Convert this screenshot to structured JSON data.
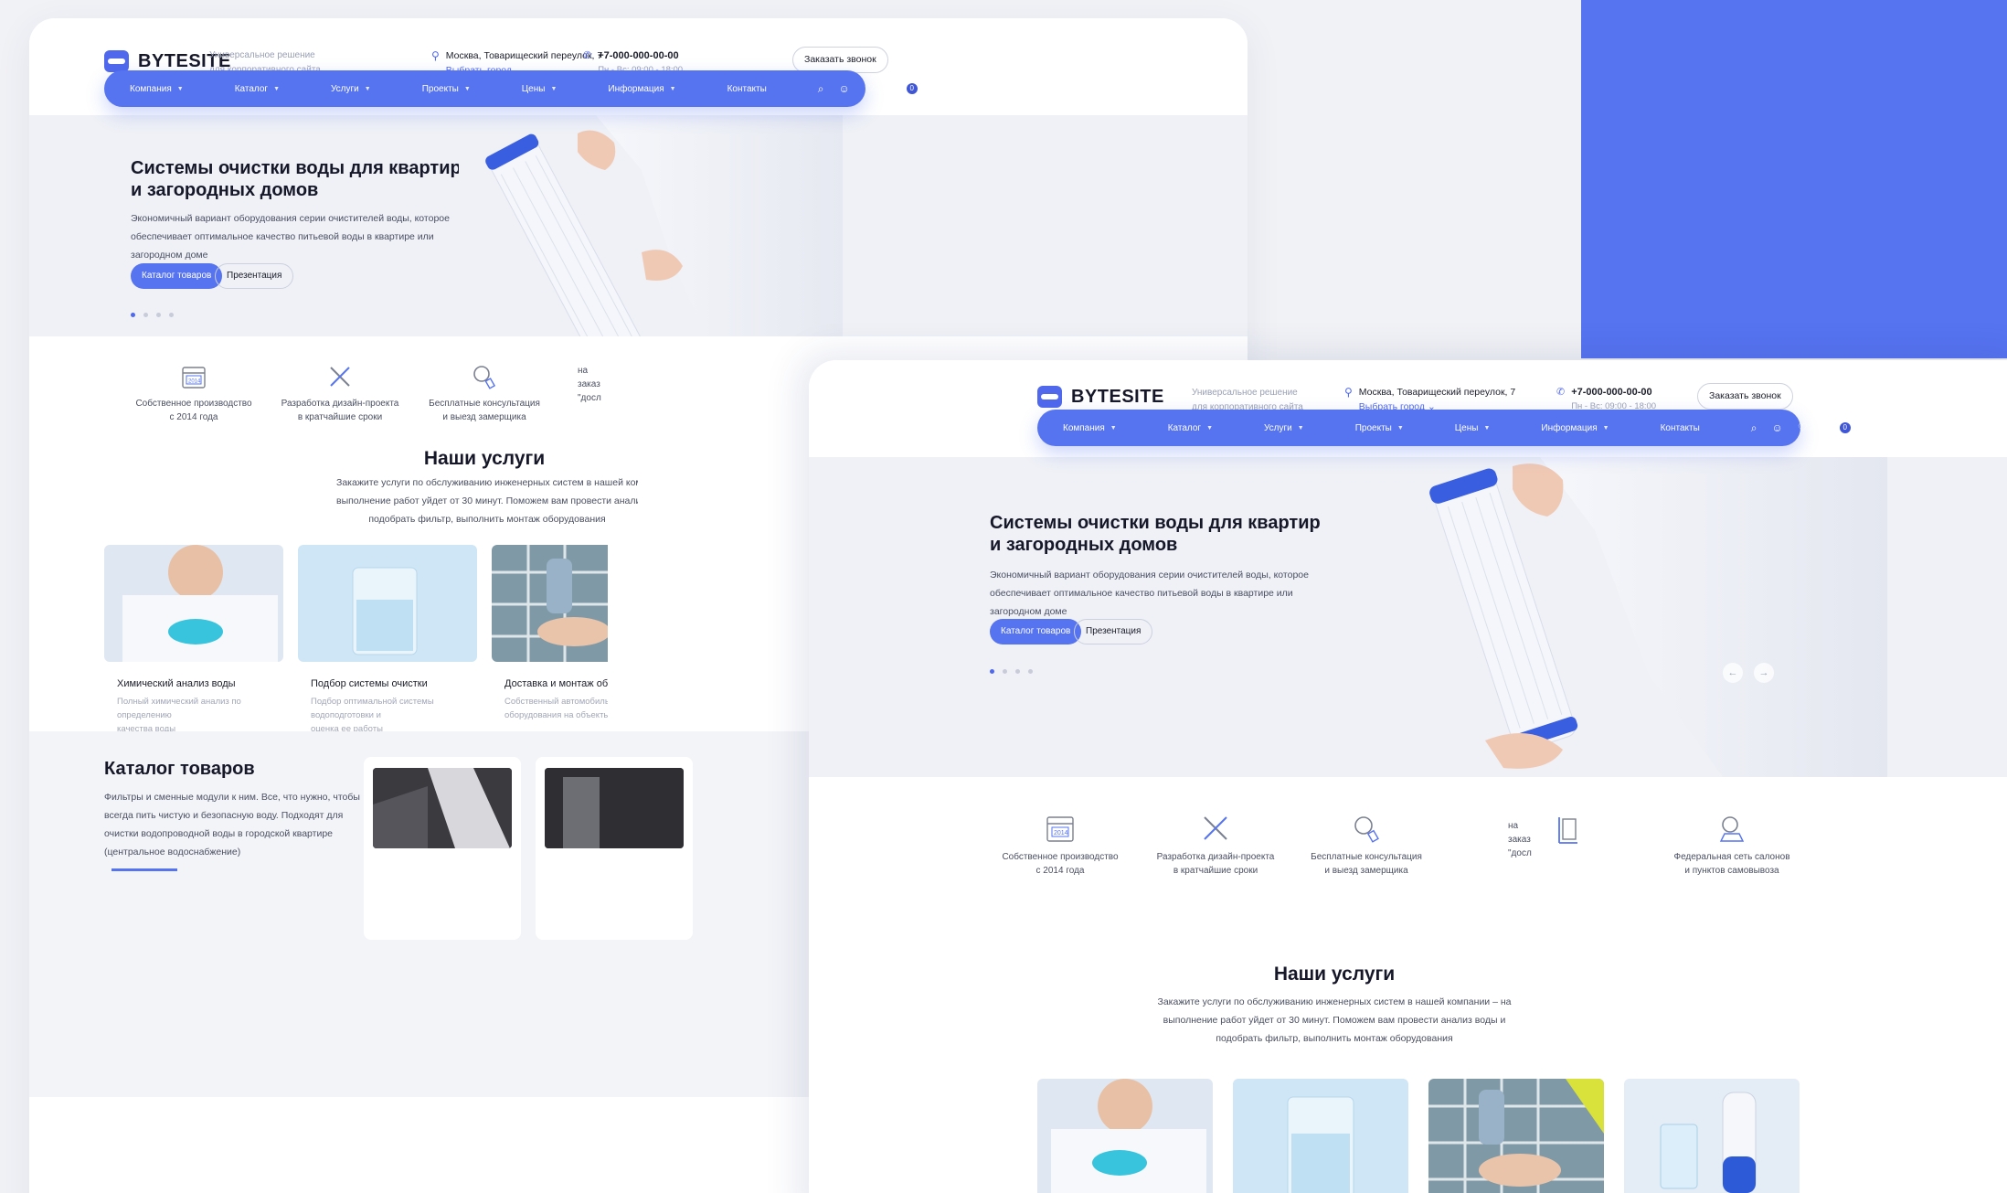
{
  "colors": {
    "accent": "#5673f0",
    "background": "#f1f2f6"
  },
  "header": {
    "logo": "BYTESITE",
    "tagline_line1": "Универсальное решение",
    "tagline_line2": "для корпоративного сайта",
    "address": "Москва, Товарищеский переулок, 7",
    "choose_city": "Выбрать город",
    "phone": "+7-000-000-00-00",
    "hours": "Пн - Вс: 09:00 - 18:00",
    "callback": "Заказать звонок"
  },
  "nav": {
    "items": [
      "Компания",
      "Каталог",
      "Услуги",
      "Проекты",
      "Цены",
      "Информация",
      "Контакты"
    ],
    "icons": [
      "search-icon",
      "user-icon",
      "heart-icon",
      "cart-icon"
    ],
    "cart_count": "0"
  },
  "hero": {
    "title_line1": "Системы очистки воды для квартир",
    "title_line2": "и загородных домов",
    "text_line1": "Экономичный вариант оборудования серии очистителей воды, которое",
    "text_line2": "обеспечивает оптимальное качество питьевой воды в квартире или",
    "text_line3": "загородном доме",
    "btn_catalog": "Каталог товаров",
    "btn_presentation": "Презентация"
  },
  "features": [
    {
      "line1": "Собственное производство",
      "line2": "с 2014 года",
      "year": "2014"
    },
    {
      "line1": "Разработка дизайн-проекта",
      "line2": "в кратчайшие сроки"
    },
    {
      "line1": "Бесплатные консультация",
      "line2": "и выезд замерщика"
    },
    {
      "line1": "на",
      "line2": "заказ",
      "line3": "\"досл"
    },
    {
      "line1": "Федеральная сеть салонов",
      "line2": "и пунктов самовывоза"
    }
  ],
  "services": {
    "title": "Наши услуги",
    "desc_line1": "Закажите услуги по обслуживанию инженерных систем в нашей компании – на",
    "desc_line2": "выполнение работ уйдет от 30 минут. Поможем вам провести анализ воды и",
    "desc_line3": "подобрать фильтр, выполнить монтаж оборудования",
    "cards": [
      {
        "title": "Химический анализ воды",
        "desc_line1": "Полный химический анализ по определению",
        "desc_line2": "качества воды"
      },
      {
        "title": "Подбор системы очистки",
        "desc_line1": "Подбор оптимальной системы водоподготовки и",
        "desc_line2": "оценка ее работы"
      },
      {
        "title": "Доставка и монтаж оборудова",
        "desc_line1": "Собственный автомобильный пар",
        "desc_line2": "оборудования на объекты"
      }
    ]
  },
  "catalog": {
    "title": "Каталог товаров",
    "text_line1": "Фильтры и сменные модули к ним. Все, что нужно, чтобы",
    "text_line2": "всегда пить чистую и безопасную воду. Подходят для",
    "text_line3": "очистки водопроводной воды в городской квартире",
    "text_line4": "(центральное водоснабжение)"
  }
}
